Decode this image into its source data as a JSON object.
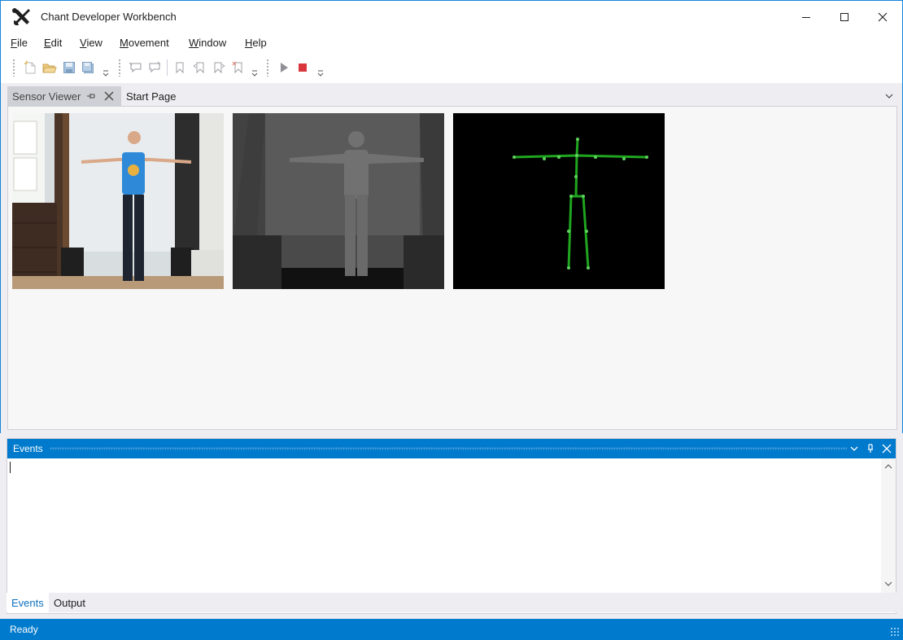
{
  "window": {
    "title": "Chant Developer Workbench",
    "icon": "wrench-screwdriver-icon"
  },
  "menu": {
    "items": [
      {
        "pre": "",
        "ul": "F",
        "post": "ile"
      },
      {
        "pre": "",
        "ul": "E",
        "post": "dit"
      },
      {
        "pre": "",
        "ul": "V",
        "post": "iew"
      },
      {
        "pre": "",
        "ul": "M",
        "post": "ovement"
      },
      {
        "pre": "",
        "ul": "W",
        "post": "indow"
      },
      {
        "pre": "",
        "ul": "H",
        "post": "elp"
      }
    ]
  },
  "toolbar": {
    "icons": [
      "new-file-icon",
      "open-folder-icon",
      "save-icon",
      "save-all-icon",
      "bookmark-icon",
      "stop-icon",
      "play-icon"
    ]
  },
  "document_tabs": {
    "active": "Sensor Viewer",
    "inactive": "Start Page"
  },
  "sensor_views": {
    "color": "color-camera-view",
    "depth": "depth-camera-view",
    "skeleton": "skeleton-view"
  },
  "events_panel": {
    "title": "Events",
    "content": ""
  },
  "bottom_tabs": {
    "active": "Events",
    "inactive": "Output"
  },
  "status": {
    "text": "Ready"
  },
  "colors": {
    "accent": "#007acc",
    "window_border": "#1883d7",
    "skeleton": "#1fa51f",
    "stop": "#d9363e"
  }
}
